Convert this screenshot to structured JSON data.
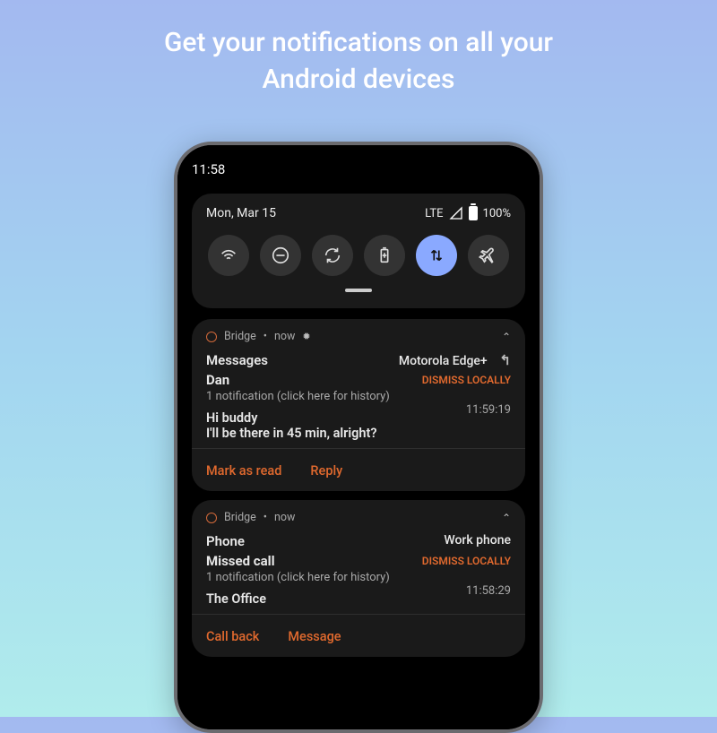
{
  "headline_line1": "Get your notifications on all your",
  "headline_line2": "Android devices",
  "statusbar": {
    "clock": "11:58",
    "date": "Mon, Mar 15",
    "lte_label": "LTE",
    "battery_pct": "100%"
  },
  "quick_settings": {
    "tiles": [
      {
        "name": "wifi",
        "active": false
      },
      {
        "name": "dnd",
        "active": false
      },
      {
        "name": "rotate",
        "active": false
      },
      {
        "name": "battery-saver",
        "active": false
      },
      {
        "name": "mobile-data",
        "active": true
      },
      {
        "name": "airplane",
        "active": false
      }
    ]
  },
  "notifications": [
    {
      "app": "Bridge",
      "when": "now",
      "category": "Messages",
      "device": "Motorola Edge+",
      "dismiss_label": "DISMISS LOCALLY",
      "sender": "Dan",
      "subtext": "1 notification (click here for history)",
      "body_line1": "Hi buddy",
      "body_line2": "I'll be there in 45 min, alright?",
      "timestamp": "11:59:19",
      "actions": [
        "Mark as read",
        "Reply"
      ]
    },
    {
      "app": "Bridge",
      "when": "now",
      "category": "Phone",
      "device": "Work phone",
      "dismiss_label": "DISMISS LOCALLY",
      "sender": "Missed call",
      "subtext": "1 notification (click here for history)",
      "body_line1": "The Office",
      "body_line2": "",
      "timestamp": "11:58:29",
      "actions": [
        "Call back",
        "Message"
      ]
    }
  ],
  "colors": {
    "accent": "#e0692e",
    "active_tile": "#8aa9ff"
  }
}
